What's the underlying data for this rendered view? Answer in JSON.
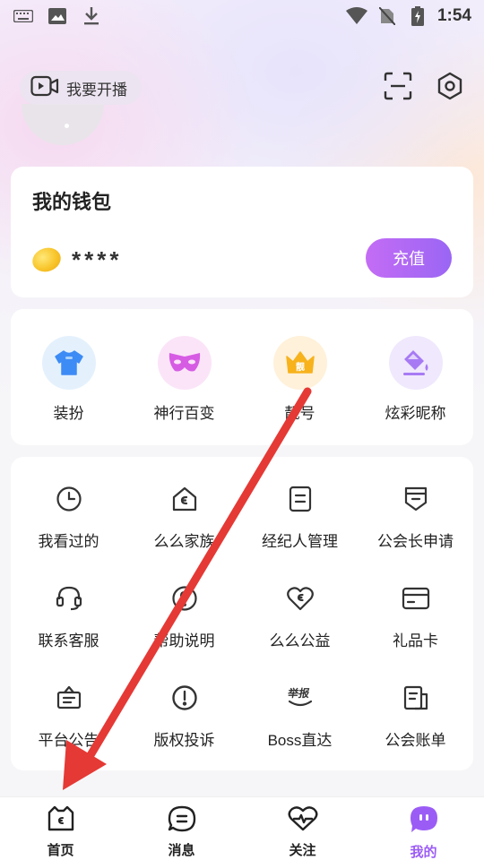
{
  "status_bar": {
    "time": "1:54",
    "icons": [
      "keyboard-icon",
      "image-icon",
      "download-icon",
      "wifi-icon",
      "no-sim-icon",
      "battery-charging-icon"
    ]
  },
  "header": {
    "live_button_label": "我要开播",
    "icons": [
      "video-camera-icon",
      "scan-icon",
      "settings-icon"
    ]
  },
  "wallet": {
    "title": "我的钱包",
    "balance": "****",
    "recharge_label": "充值"
  },
  "features": [
    {
      "label": "装扮",
      "icon": "tshirt-icon",
      "color": "#3d8bf5",
      "bg": "#e4f1fd"
    },
    {
      "label": "神行百变",
      "icon": "mask-icon",
      "color": "#d65ce4",
      "bg": "#fbe4f8"
    },
    {
      "label": "靓号",
      "icon": "crown-icon",
      "badge": "靓",
      "color": "#f7b21c",
      "bg": "#fff1da"
    },
    {
      "label": "炫彩昵称",
      "icon": "paint-bucket-icon",
      "color": "#a77af4",
      "bg": "#f0e8fd"
    }
  ],
  "menu": [
    {
      "label": "我看过的",
      "icon": "clock-icon"
    },
    {
      "label": "么么家族",
      "icon": "house-icon"
    },
    {
      "label": "经纪人管理",
      "icon": "document-icon"
    },
    {
      "label": "公会长申请",
      "icon": "badge-icon"
    },
    {
      "label": "联系客服",
      "icon": "headset-icon"
    },
    {
      "label": "帮助说明",
      "icon": "help-icon"
    },
    {
      "label": "么么公益",
      "icon": "heart-icon"
    },
    {
      "label": "礼品卡",
      "icon": "card-icon"
    },
    {
      "label": "平台公告",
      "icon": "announcement-icon"
    },
    {
      "label": "版权投诉",
      "icon": "warning-icon"
    },
    {
      "label": "Boss直达",
      "icon": "report-stamp-icon",
      "stamp_text": "举报"
    },
    {
      "label": "公会账单",
      "icon": "bill-icon"
    }
  ],
  "bottom_nav": [
    {
      "label": "首页",
      "icon": "home-cat-icon",
      "active": false
    },
    {
      "label": "消息",
      "icon": "message-icon",
      "active": false
    },
    {
      "label": "关注",
      "icon": "heart-pulse-icon",
      "active": false
    },
    {
      "label": "我的",
      "icon": "profile-icon",
      "active": true
    }
  ],
  "colors": {
    "accent": "#9b5cf6",
    "recharge_gradient_start": "#c46cf5",
    "recharge_gradient_end": "#9a66f4",
    "arrow": "#e53935"
  }
}
